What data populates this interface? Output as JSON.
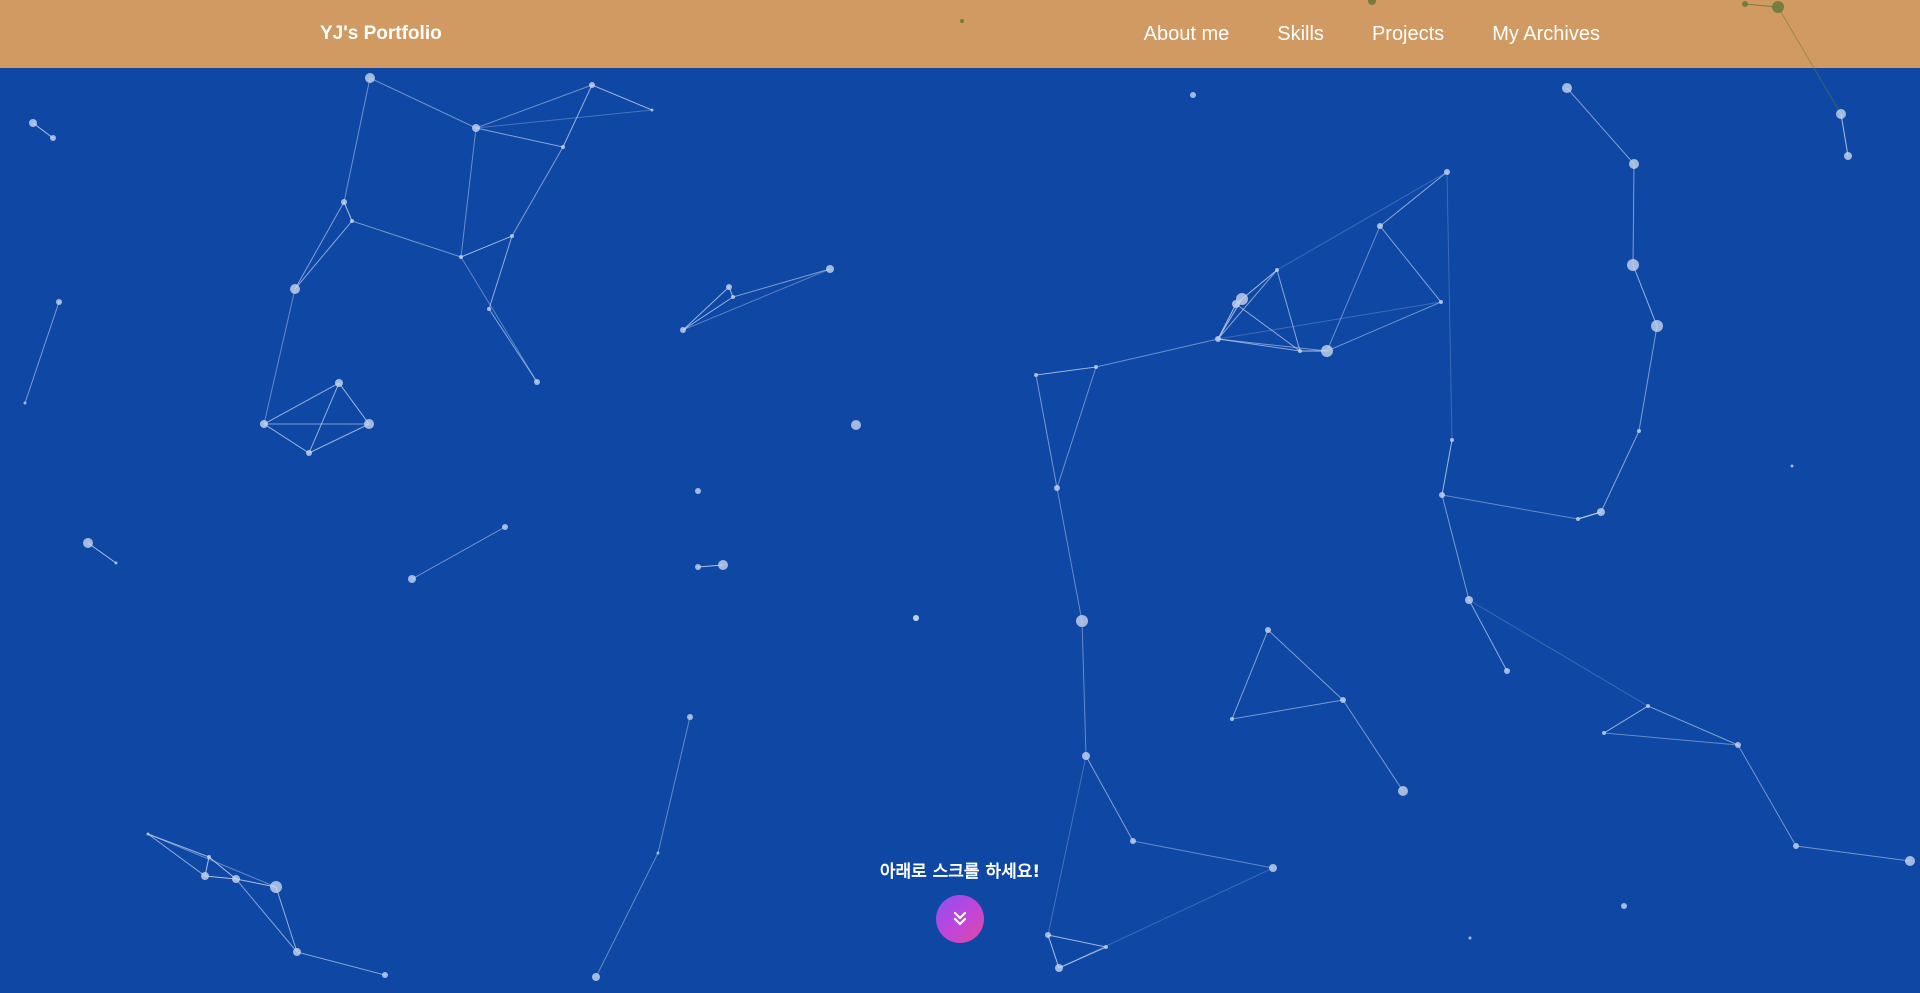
{
  "nav": {
    "brand": "YJ's Portfolio",
    "links": [
      "About me",
      "Skills",
      "Projects",
      "My Archives"
    ]
  },
  "hero": {
    "scroll_hint": "아래로 스크롤 하세요!",
    "scroll_icon": "double-chevron-down-icon"
  },
  "colors": {
    "navbar": "#d09a62",
    "background": "#0e47a4",
    "particle": "#c9d6ef",
    "scroll_button_gradient": [
      "#8e4ff2",
      "#e04a9e"
    ]
  }
}
